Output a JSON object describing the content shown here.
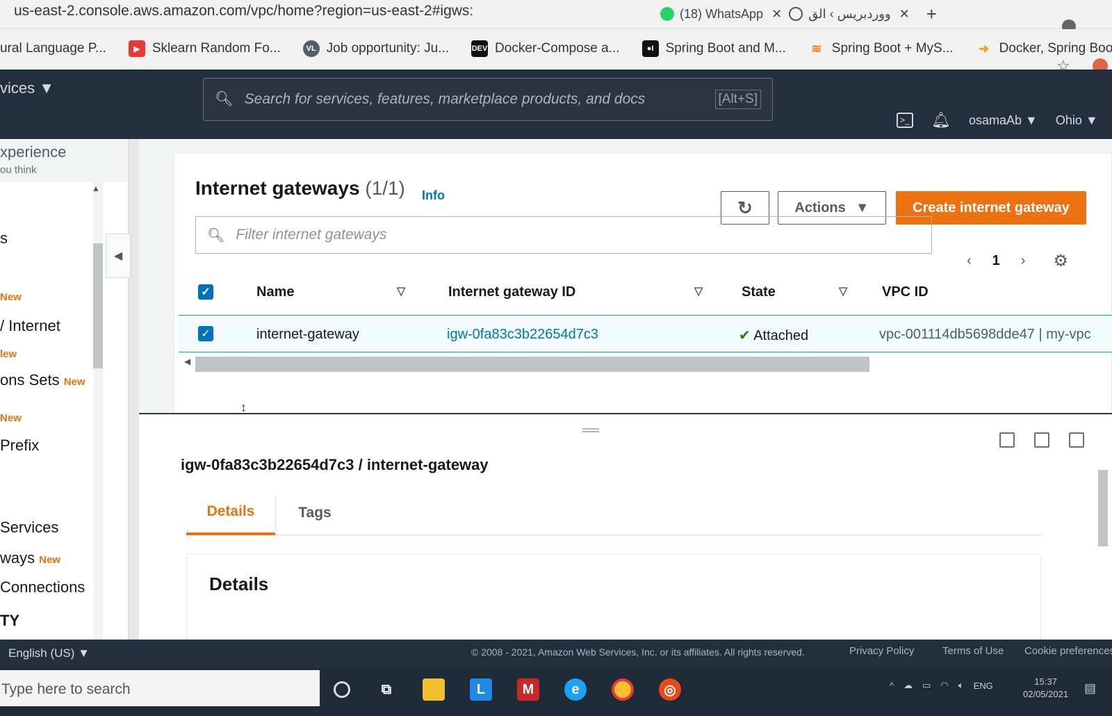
{
  "browser": {
    "url": "us-east-2.console.aws.amazon.com/vpc/home?region=us-east-2#igws:",
    "tabs": [
      {
        "label": "(18) WhatsApp"
      },
      {
        "label": "ووردبريس › الق"
      }
    ],
    "bookmarks": [
      {
        "label": "ural Language P...",
        "icon": "none"
      },
      {
        "label": "Sklearn Random Fo...",
        "icon": "youtube-icon",
        "color": "#e53935"
      },
      {
        "label": "Job opportunity: Ju...",
        "icon": "vl-icon",
        "badge": "VL",
        "color": "#555d66"
      },
      {
        "label": "Docker-Compose a...",
        "icon": "dev-icon",
        "badge": "DEV",
        "color": "#111111"
      },
      {
        "label": "Spring Boot and M...",
        "icon": "medium-icon",
        "badge": "●I",
        "color": "#111111"
      },
      {
        "label": "Spring Boot + MyS...",
        "icon": "stackoverflow-icon",
        "color": "#f48024"
      },
      {
        "label": "Docker, Spring Boo...",
        "icon": "arrow-icon",
        "color": "#f4a024"
      }
    ]
  },
  "aws_nav": {
    "services_label": "vices",
    "search_placeholder": "Search for services, features, marketplace products, and docs",
    "search_shortcut": "[Alt+S]",
    "user": "osamaAb",
    "region": "Ohio"
  },
  "sidebar": {
    "experience": "xperience",
    "think": "ou think",
    "items": [
      {
        "label": "s",
        "new": ""
      },
      {
        "label": "",
        "new": "New"
      },
      {
        "label": "Internet",
        "new": ""
      },
      {
        "label": "",
        "new": "lew"
      },
      {
        "label": "ons Sets",
        "new": "New"
      },
      {
        "label": "",
        "new": "New"
      },
      {
        "label": "Prefix",
        "new": ""
      },
      {
        "label": "Services",
        "new": ""
      },
      {
        "label": "ways",
        "new": "New"
      },
      {
        "label": "Connections",
        "new": ""
      },
      {
        "label": "TY",
        "new": ""
      }
    ]
  },
  "main": {
    "title": "Internet gateways",
    "count": "(1/1)",
    "info": "Info",
    "actions_label": "Actions",
    "create_label": "Create internet gateway",
    "filter_placeholder": "Filter internet gateways",
    "page": "1",
    "columns": [
      "Name",
      "Internet gateway ID",
      "State",
      "VPC ID"
    ],
    "row": {
      "name": "internet-gateway",
      "id": "igw-0fa83c3b22654d7c3",
      "state": "Attached",
      "vpc": "vpc-001114db5698dde47 | my-vpc"
    }
  },
  "details": {
    "title": "igw-0fa83c3b22654d7c3 / internet-gateway",
    "tabs": [
      "Details",
      "Tags"
    ],
    "section_title": "Details"
  },
  "footer": {
    "language": "English (US)",
    "copyright": "© 2008 - 2021, Amazon Web Services, Inc. or its affiliates. All rights reserved.",
    "privacy": "Privacy Policy",
    "terms": "Terms of Use",
    "cookies": "Cookie preferences"
  },
  "taskbar": {
    "search_placeholder": "Type here to search",
    "lang": "ENG",
    "time": "15:37",
    "date": "02/05/2021"
  },
  "colors": {
    "aws_orange": "#ec7211",
    "aws_navy": "#232f3e",
    "link_blue": "#0073bb",
    "success_green": "#1d8102"
  }
}
